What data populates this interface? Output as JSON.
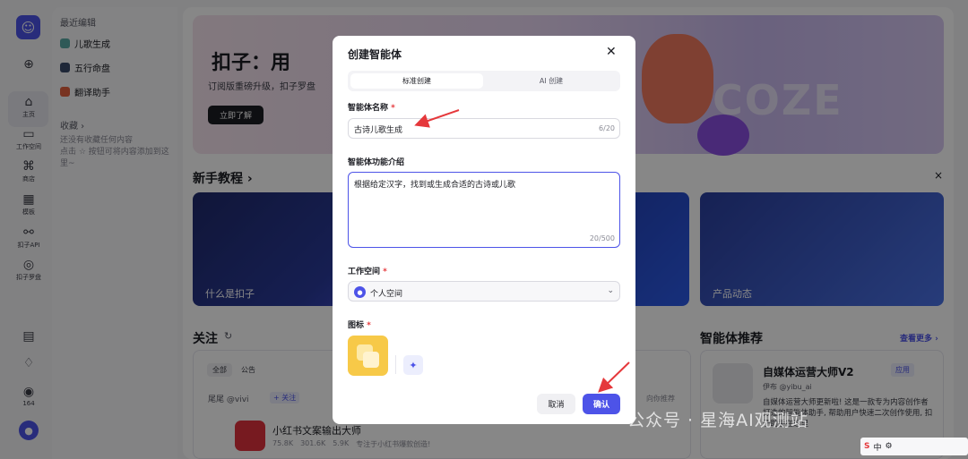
{
  "rail": {
    "items": [
      {
        "icon": "add-icon",
        "label": ""
      },
      {
        "icon": "home-icon",
        "label": "主页"
      },
      {
        "icon": "workspace-icon",
        "label": "工作空间"
      },
      {
        "icon": "store-icon",
        "label": "商店"
      },
      {
        "icon": "template-icon",
        "label": "模板"
      },
      {
        "icon": "api-icon",
        "label": "扣子API"
      },
      {
        "icon": "compass-icon",
        "label": "扣子罗盘"
      }
    ],
    "badge_count": "164"
  },
  "sidebar": {
    "recent_title": "最近编辑",
    "recent_items": [
      "儿歌生成",
      "五行命盘",
      "翻译助手"
    ],
    "favorites_title": "收藏 ›",
    "favorites_empty": "还没有收藏任何内容",
    "favorites_hint": "点击 ☆ 按钮可将内容添加到这里~"
  },
  "banner": {
    "title": "扣子：用",
    "subtitle": "订阅版重磅升级，扣子罗盘",
    "button": "立即了解",
    "bg_text": "COZE"
  },
  "tutorials": {
    "title": "新手教程 ›",
    "cards": [
      "什么是扣子",
      "",
      "产品动态"
    ]
  },
  "follow": {
    "title": "关注",
    "tabs": [
      "全部",
      "公告"
    ],
    "user": "尾尾 @vivi",
    "follow_btn": "+ 关注",
    "hint": "向你推荐",
    "item_title": "小红书文案输出大师",
    "item_stats": [
      "75.8K",
      "301.6K",
      "5.9K"
    ],
    "item_desc": "专注于小红书爆款创造!"
  },
  "recommend": {
    "title": "智能体推荐",
    "more": "查看更多 ›",
    "item_title": "自媒体运营大师V2",
    "item_author": "伊布 @yibu_ai",
    "item_tag": "应用",
    "item_desc": "自媒体运营大师更新啦! 这是一款专为内容创作者打造的智能体助手, 帮助用户快速二次创作使用, 扣子助手在这里"
  },
  "modal": {
    "title": "创建智能体",
    "tabs": [
      "标准创建",
      "AI 创建"
    ],
    "name_label": "智能体名称",
    "name_value": "古诗儿歌生成",
    "name_count": "6/20",
    "desc_label": "智能体功能介绍",
    "desc_value": "根据给定汉字，找到或生成合适的古诗或儿歌",
    "desc_count": "20/500",
    "workspace_label": "工作空间",
    "workspace_value": "个人空间",
    "icon_label": "图标",
    "cancel": "取消",
    "confirm": "确认",
    "required_mark": "*"
  },
  "watermark": "公众号 · 星海AI观测站",
  "ime": "中",
  "colors": {
    "accent": "#4d53e8",
    "arrow": "#e5383b",
    "required": "#e5383b"
  }
}
